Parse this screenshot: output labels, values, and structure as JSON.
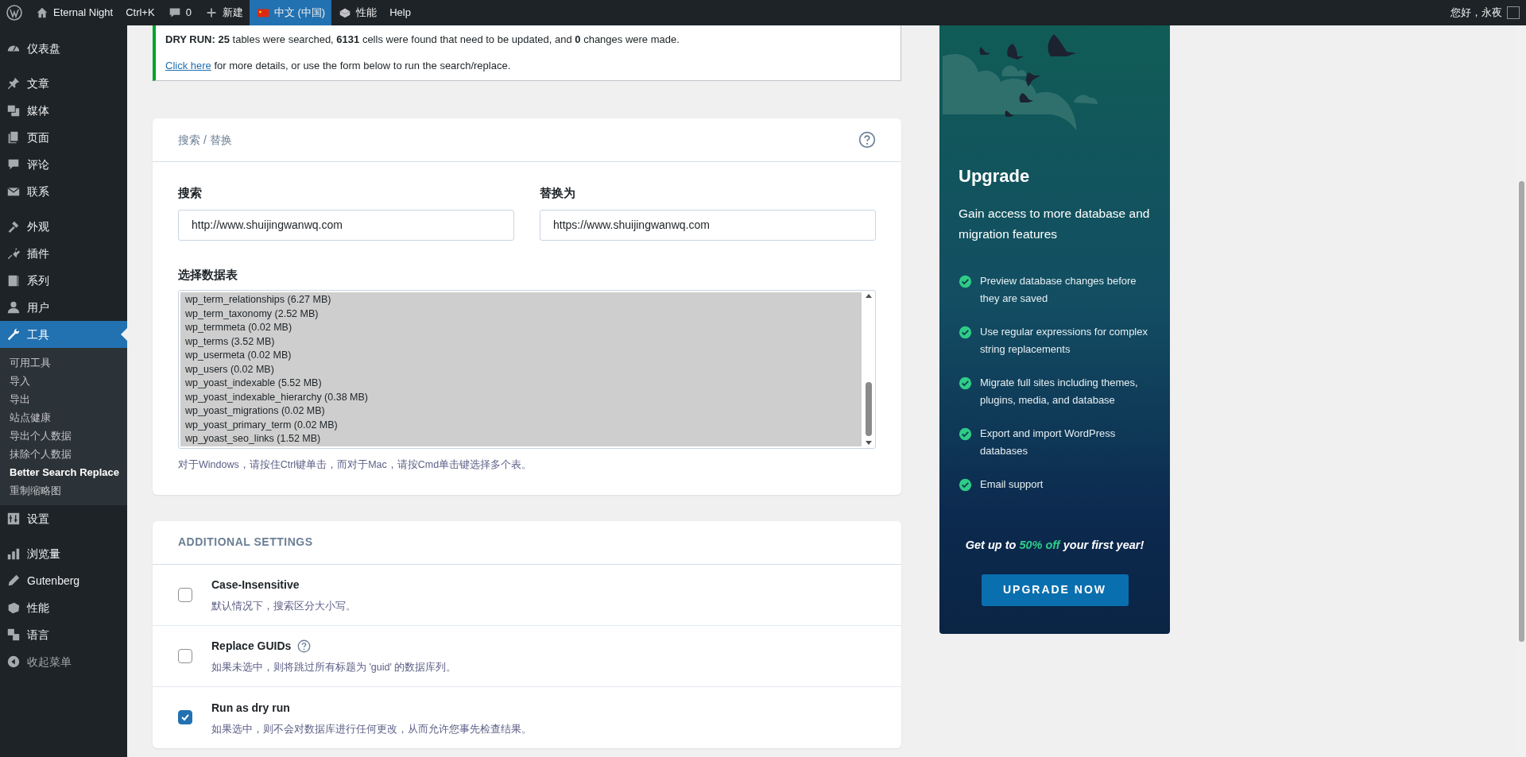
{
  "admin_bar": {
    "items": [
      {
        "label": "Eternal Night",
        "selected": false
      },
      {
        "label": "Ctrl+K",
        "selected": false
      },
      {
        "label": "0",
        "selected": false
      },
      {
        "label": "新建",
        "selected": false
      },
      {
        "label": "中文 (中国)",
        "selected": true
      },
      {
        "label": "性能",
        "selected": false
      },
      {
        "label": "Help",
        "selected": false
      }
    ],
    "greeting": "您好，永夜"
  },
  "sidebar": {
    "items": [
      {
        "label": "仪表盘",
        "selected": false,
        "gap_before": false
      },
      {
        "label": "文章",
        "selected": false,
        "gap_before": true
      },
      {
        "label": "媒体",
        "selected": false,
        "gap_before": false
      },
      {
        "label": "页面",
        "selected": false,
        "gap_before": false
      },
      {
        "label": "评论",
        "selected": false,
        "gap_before": false
      },
      {
        "label": "联系",
        "selected": false,
        "gap_before": false
      },
      {
        "label": "外观",
        "selected": false,
        "gap_before": true
      },
      {
        "label": "插件",
        "selected": false,
        "gap_before": false
      },
      {
        "label": "系列",
        "selected": false,
        "gap_before": false
      },
      {
        "label": "用户",
        "selected": false,
        "gap_before": false
      },
      {
        "label": "工具",
        "selected": true,
        "gap_before": false,
        "children": [
          {
            "label": "可用工具",
            "selected": false
          },
          {
            "label": "导入",
            "selected": false
          },
          {
            "label": "导出",
            "selected": false
          },
          {
            "label": "站点健康",
            "selected": false
          },
          {
            "label": "导出个人数据",
            "selected": false
          },
          {
            "label": "抹除个人数据",
            "selected": false
          },
          {
            "label": "Better Search Replace",
            "selected": true
          },
          {
            "label": "重制缩略图",
            "selected": false
          }
        ]
      },
      {
        "label": "设置",
        "selected": false,
        "gap_before": false
      },
      {
        "label": "浏览量",
        "selected": false,
        "gap_before": true
      },
      {
        "label": "Gutenberg",
        "selected": false,
        "gap_before": false
      },
      {
        "label": "性能",
        "selected": false,
        "gap_before": false
      },
      {
        "label": "语言",
        "selected": false,
        "gap_before": false
      },
      {
        "label": "收起菜单",
        "selected": false,
        "gap_before": false
      }
    ]
  },
  "notice": {
    "summary": "**DRY RUN:** **25** tables were searched, **6131** cells were found that need to be updated, and **0** changes were made.",
    "link": "Click here",
    "after_link": "for more details, or use the form below to run the search/replace."
  },
  "search_replace": {
    "title": "搜索 / 替换",
    "search_label": "搜索",
    "search_value": "http://www.shuijingwanwq.com",
    "replace_label": "替换为",
    "replace_value": "https://www.shuijingwanwq.com",
    "tables_label": "选择数据表",
    "tables": [
      {
        "label": "wp_term_relationships (6.27 MB)",
        "selected": true
      },
      {
        "label": "wp_term_taxonomy (2.52 MB)",
        "selected": true
      },
      {
        "label": "wp_termmeta (0.02 MB)",
        "selected": true
      },
      {
        "label": "wp_terms (3.52 MB)",
        "selected": true
      },
      {
        "label": "wp_usermeta (0.02 MB)",
        "selected": true
      },
      {
        "label": "wp_users (0.02 MB)",
        "selected": true
      },
      {
        "label": "wp_yoast_indexable (5.52 MB)",
        "selected": true
      },
      {
        "label": "wp_yoast_indexable_hierarchy (0.38 MB)",
        "selected": true
      },
      {
        "label": "wp_yoast_migrations (0.02 MB)",
        "selected": true
      },
      {
        "label": "wp_yoast_primary_term (0.02 MB)",
        "selected": true
      },
      {
        "label": "wp_yoast_seo_links (1.52 MB)",
        "selected": true
      }
    ],
    "hint": "对于Windows，请按住Ctrl键单击，而对于Mac，请按Cmd单击键选择多个表。"
  },
  "additional_settings": {
    "title": "ADDITIONAL SETTINGS",
    "options": [
      {
        "label": "Case-Insensitive",
        "description": "默认情况下，搜索区分大小写。",
        "checked": false,
        "help": false
      },
      {
        "label": "Replace GUIDs",
        "description": "如果未选中，则将跳过所有标题为 'guid' 的数据库列。",
        "checked": false,
        "help": true
      },
      {
        "label": "Run as dry run",
        "description": "如果选中，则不会对数据库进行任何更改，从而允许您事先检查结果。",
        "checked": true,
        "help": false
      }
    ]
  },
  "upgrade": {
    "title": "Upgrade",
    "description": "Gain access to more database and migration features",
    "features": [
      "Preview database changes before they are saved",
      "Use regular expressions for complex string replacements",
      "Migrate full sites including themes, plugins, media, and database",
      "Export and import WordPress databases",
      "Email support"
    ],
    "offer_before": "Get up to",
    "offer_highlight": "50% off",
    "offer_after": "your first year!",
    "button": "UPGRADE NOW"
  }
}
